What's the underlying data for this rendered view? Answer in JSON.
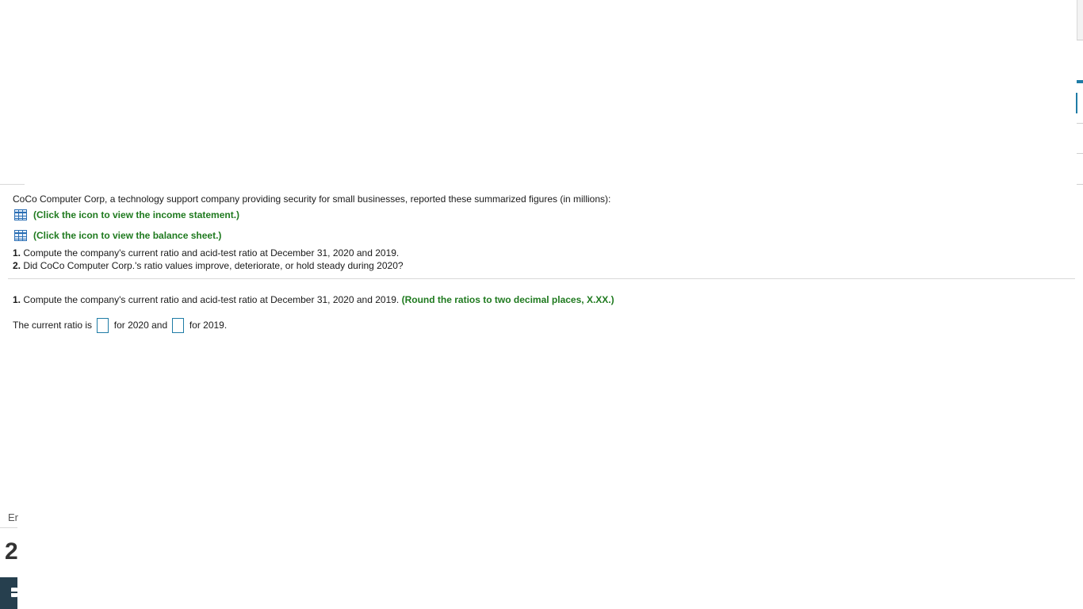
{
  "intro": "CoCo Computer Corp, a technology support company providing security for small businesses, reported these summarized figures (in millions):",
  "links": {
    "income": "(Click the icon to view the income statement.)",
    "balance": "(Click the icon to view the balance sheet.)"
  },
  "questions": [
    {
      "num": "1.",
      "text": " Compute the company's current ratio and acid-test ratio at December 31, 2020 and 2019."
    },
    {
      "num": "2.",
      "text": " Did CoCo Computer Corp.'s ratio values improve, deteriorate, or hold steady during 2020?"
    }
  ],
  "part1": {
    "num": "1.",
    "text": " Compute the company's current ratio and acid-test ratio at December 31, 2020 and 2019. ",
    "hint": "(Round the ratios to two decimal places, X.XX.)"
  },
  "answer": {
    "prefix": "The current ratio is",
    "mid": "for 2020 and",
    "suffix": "for 2019.",
    "value_2020": "",
    "value_2019": ""
  },
  "left_fragments": {
    "label": "Er",
    "number": "2"
  },
  "colors": {
    "hint_green": "#1f7a1f",
    "accent_blue": "#1f7ca6",
    "dark_panel": "#263f4e"
  },
  "icons": {
    "table": "table-grid-icon"
  }
}
